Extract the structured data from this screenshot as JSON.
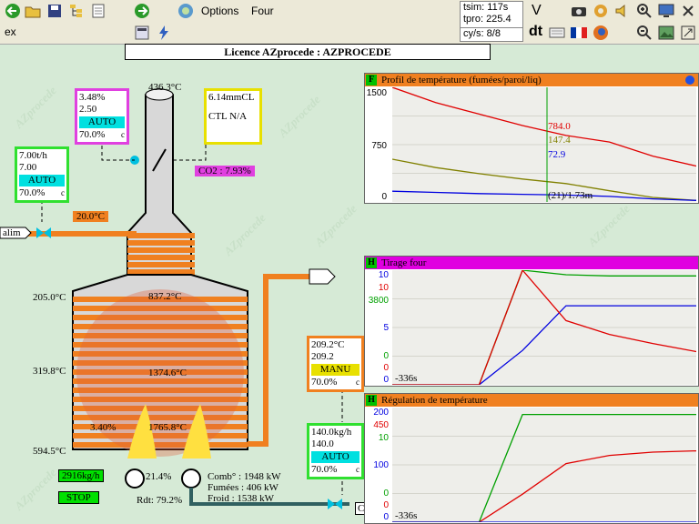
{
  "toolbar": {
    "options_label": "Options",
    "four_label": "Four",
    "tsim": "tsim: 117s",
    "tpro": "tpro: 225.4",
    "cys": "cy/s: 8/8",
    "v_label": "V",
    "dt_label": "dt",
    "ex_label": "ex"
  },
  "banner": "Licence AZprocede : AZPROCEDE",
  "watermark": "AZprocede",
  "controllers": {
    "top_left": {
      "line1": "3.48%",
      "line2": "2.50",
      "mode": "AUTO",
      "line3": "70.0%",
      "flag": "c"
    },
    "cl": {
      "line1": "6.14mmCL",
      "line2": "CTL N/A"
    },
    "left_flow": {
      "line1": "7.00t/h",
      "line2": "7.00",
      "mode": "AUTO",
      "line3": "70.0%",
      "flag": "c"
    },
    "mid_temp": {
      "line1": "209.2°C",
      "line2": "209.2",
      "mode": "MANU",
      "line3": "70.0%",
      "flag": "c"
    },
    "bottom_flow": {
      "line1": "140.0kg/h",
      "line2": "140.0",
      "mode": "AUTO",
      "line3": "70.0%",
      "flag": "c"
    }
  },
  "labels": {
    "stack_temp": "436.3°C",
    "co2": "CO2 : 7.93%",
    "feed_temp": "20.0°C",
    "alim": "alim",
    "t205": "205.0°C",
    "t837": "837.2°C",
    "t319": "319.8°C",
    "t1374": "1374.6°C",
    "t594": "594.5°C",
    "pct340": "3.40%",
    "t1765": "1765.8°C",
    "flow2916": "2916kg/h",
    "pct214": "21.4%",
    "rdt": "Rdt: 79.2%",
    "stop": "STOP",
    "comb": "Comb° : 1948 kW",
    "fumees": "Fumées : 406 kW",
    "froid": "Froid  : 1538 kW",
    "cl_tag": "CL"
  },
  "panels": {
    "p1": {
      "letter": "F",
      "title": "Profil de température (fumées/paroi/liq)",
      "yticks": [
        "1500",
        "750",
        "0"
      ],
      "v784": "784.0",
      "v147": "147.4",
      "v729": "72.9",
      "pos": "(21)/1.73m",
      "colors": {
        "title": "#f08020",
        "fumees": "#e00000",
        "paroi": "#808000",
        "liq": "#0000e0"
      }
    },
    "p2": {
      "letter": "H",
      "title": "Tirage four",
      "ytop": [
        "10",
        "10",
        "3800"
      ],
      "ymid": "5",
      "ybot": [
        "0",
        "0",
        "0"
      ],
      "tleft": "-336s",
      "colors": {
        "title": "#e000e0"
      }
    },
    "p3": {
      "letter": "H",
      "title": "Régulation de température",
      "ytop": [
        "200",
        "450",
        "10"
      ],
      "ymid": "100",
      "ybot": [
        "0",
        "0",
        "0"
      ],
      "tleft": "-336s",
      "colors": {
        "title": "#f08020"
      }
    }
  },
  "chart_data": [
    {
      "type": "line",
      "title": "Profil de température (fumées/paroi/liq)",
      "ylim": [
        0,
        1500
      ],
      "series": [
        {
          "color": "#e00000",
          "values": [
            1500,
            1300,
            1150,
            1000,
            870,
            784,
            600,
            470
          ]
        },
        {
          "color": "#808000",
          "values": [
            560,
            450,
            370,
            300,
            240,
            147,
            60,
            20
          ]
        },
        {
          "color": "#0000e0",
          "values": [
            140,
            125,
            110,
            100,
            90,
            72.9,
            40,
            20
          ]
        }
      ]
    },
    {
      "type": "line",
      "title": "Tirage four",
      "series": [
        {
          "color": "#00a000",
          "values": [
            0,
            0,
            0,
            10,
            9.6,
            9.5,
            9.5,
            9.5
          ]
        },
        {
          "color": "#0000e0",
          "values": [
            0,
            0,
            0,
            3,
            6.9,
            6.9,
            6.9,
            6.9
          ]
        },
        {
          "color": "#e00000",
          "values": [
            0,
            0,
            0,
            10,
            5.6,
            4.4,
            3.6,
            2.9
          ]
        }
      ]
    },
    {
      "type": "line",
      "title": "Régulation de température",
      "series": [
        {
          "color": "#00a000",
          "values": [
            0,
            0,
            0,
            9.4,
            9.4,
            9.4,
            9.4,
            9.4
          ]
        },
        {
          "color": "#e00000",
          "values": [
            0,
            0,
            0,
            110,
            230,
            262,
            275,
            280
          ]
        },
        {
          "color": "#0000e0",
          "values": [
            0,
            0,
            0,
            0,
            0,
            0,
            0,
            0
          ]
        }
      ]
    }
  ]
}
